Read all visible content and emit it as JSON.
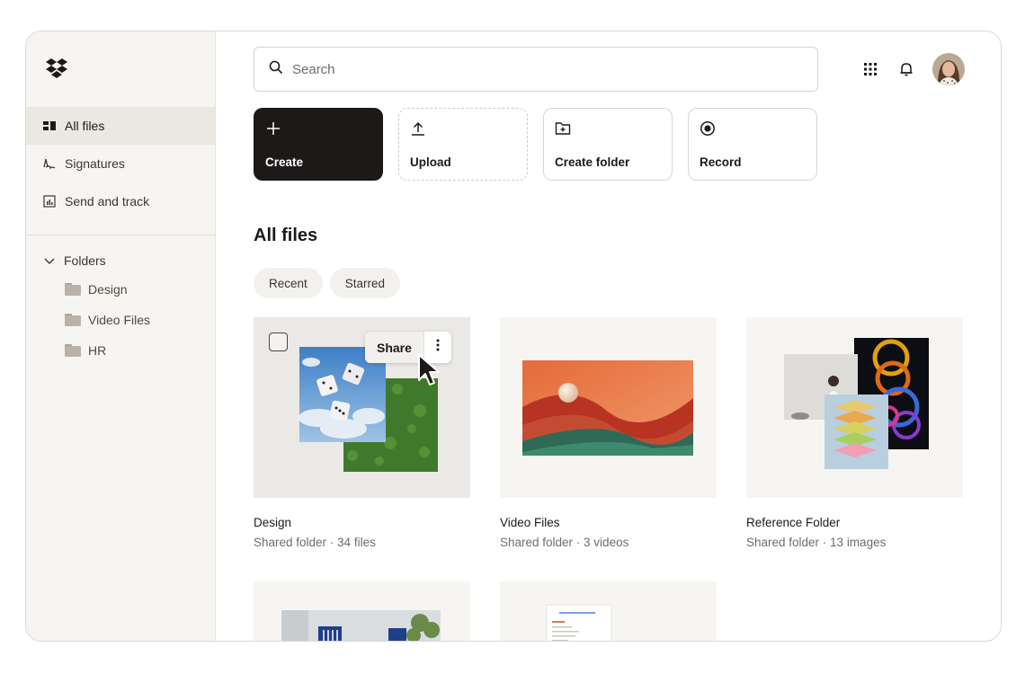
{
  "sidebar": {
    "nav": [
      {
        "label": "All files",
        "icon": "all-files-icon",
        "active": true
      },
      {
        "label": "Signatures",
        "icon": "signature-icon",
        "active": false
      },
      {
        "label": "Send and track",
        "icon": "send-track-icon",
        "active": false
      }
    ],
    "folders_label": "Folders",
    "folders": [
      {
        "label": "Design"
      },
      {
        "label": "Video Files"
      },
      {
        "label": "HR"
      }
    ]
  },
  "search": {
    "placeholder": "Search"
  },
  "actions": [
    {
      "label": "Create",
      "icon": "plus-icon"
    },
    {
      "label": "Upload",
      "icon": "upload-icon"
    },
    {
      "label": "Create folder",
      "icon": "create-folder-icon"
    },
    {
      "label": "Record",
      "icon": "record-icon"
    }
  ],
  "section_title": "All files",
  "filters": [
    {
      "label": "Recent"
    },
    {
      "label": "Starred"
    }
  ],
  "cards": [
    {
      "name": "Design",
      "meta": "Shared folder · 34 files"
    },
    {
      "name": "Video Files",
      "meta": "Shared folder · 3 videos"
    },
    {
      "name": "Reference Folder",
      "meta": "Shared folder · 13 images"
    }
  ],
  "share_label": "Share",
  "colors": {
    "accent_dark": "#1e1919",
    "sidebar_bg": "#f7f5f2",
    "muted_text": "#736c64"
  }
}
